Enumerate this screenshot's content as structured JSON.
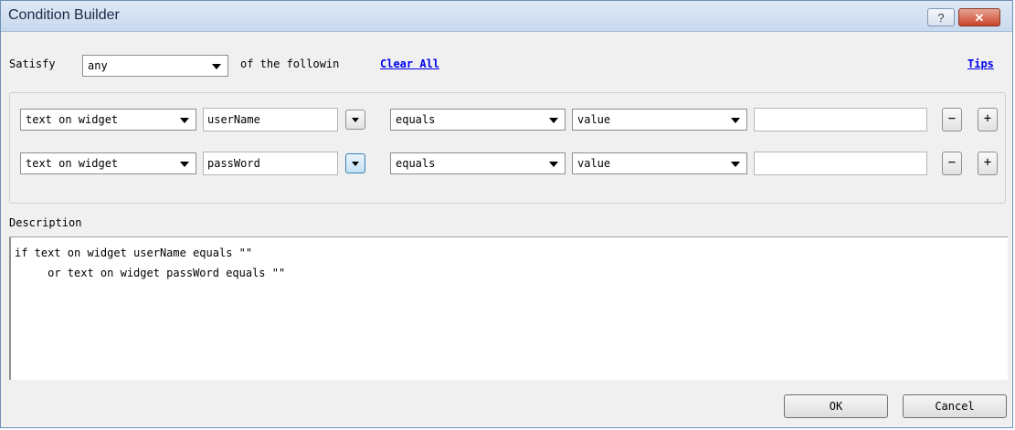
{
  "window": {
    "title": "Condition Builder",
    "help_glyph": "?",
    "close_glyph": "✕"
  },
  "satisfy": {
    "label": "Satisfy",
    "mode": "any",
    "suffix": "of the followin",
    "clear_all": "Clear All",
    "tips": "Tips"
  },
  "conditions": [
    {
      "source": "text on widget",
      "widget": "userName",
      "operator": "equals",
      "value_type": "value",
      "value": ""
    },
    {
      "source": "text on widget",
      "widget": "passWord",
      "operator": "equals",
      "value_type": "value",
      "value": ""
    }
  ],
  "row_buttons": {
    "minus": "−",
    "plus": "+"
  },
  "description": {
    "label": "Description",
    "lines": [
      "if text on widget userName equals \"\"",
      "     or text on widget passWord equals \"\""
    ]
  },
  "footer": {
    "ok": "OK",
    "cancel": "Cancel"
  },
  "icons": {
    "help": "help-icon",
    "close": "close-icon",
    "dropdown": "chevron-down-icon"
  },
  "colors": {
    "link": "#0000ee",
    "close_button": "#c9432b",
    "title_bar": "#c9d9ee"
  }
}
